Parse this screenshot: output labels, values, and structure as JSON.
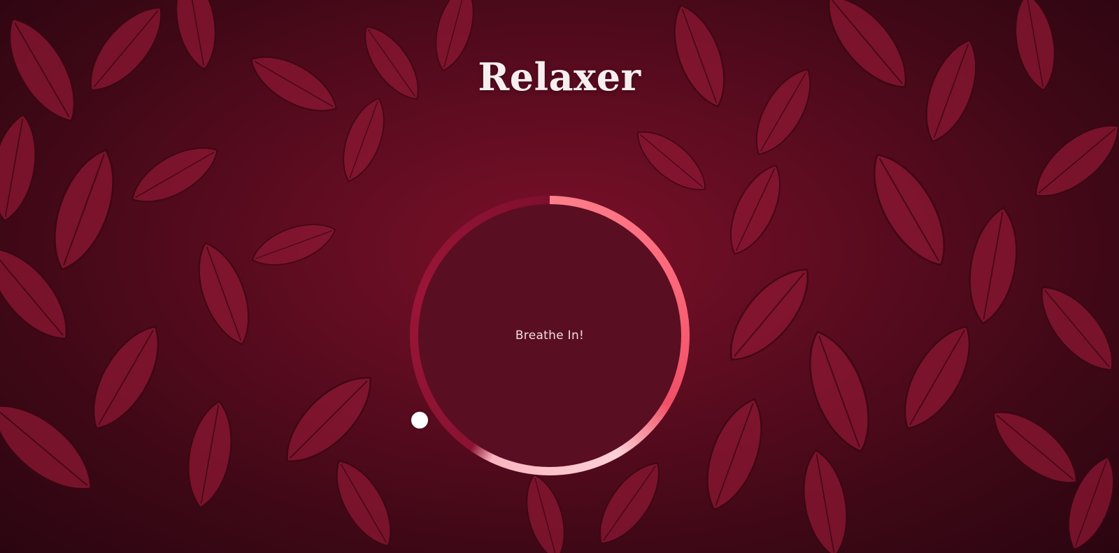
{
  "app": {
    "title": "Relaxer"
  },
  "breathing": {
    "instruction": "Breathe In!"
  },
  "colors": {
    "background": "#5e0c20",
    "circle_fill": "#5a0e22",
    "ring_pink": "#fd6a7c",
    "ring_light": "#fcd0d6",
    "ring_dark": "#8a1232",
    "pointer": "#ffffff",
    "title_text": "#f7eef0"
  }
}
